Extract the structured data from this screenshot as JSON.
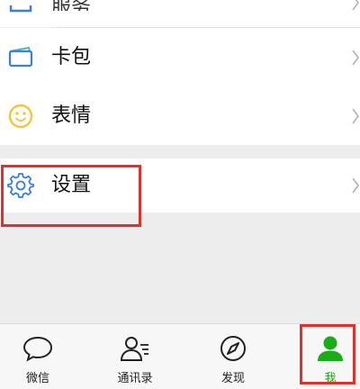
{
  "list": {
    "partial_label": "服务",
    "card_label": "卡包",
    "emoji_label": "表情",
    "settings_label": "设置"
  },
  "tabbar": {
    "chats": "微信",
    "contacts": "通讯录",
    "discover": "发现",
    "me": "我"
  },
  "colors": {
    "active_green": "#1aad19",
    "highlight_red": "#e0302e",
    "icon_blue": "#3b7ddd",
    "emoji_yellow": "#f4c53b"
  }
}
